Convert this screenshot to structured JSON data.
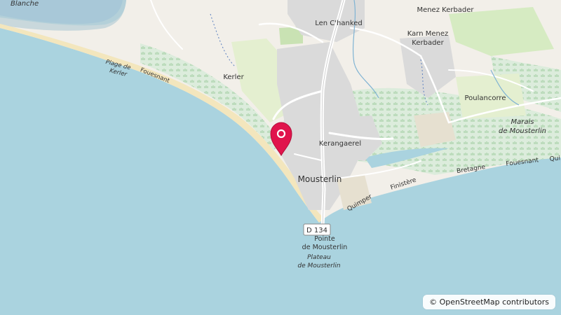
{
  "map": {
    "place_labels": {
      "blanche": "Blanche",
      "len_chanked": "Len C'hanked",
      "menez_kerbader": "Menez Kerbader",
      "karn_menez": "Karn Menez",
      "kerbader": "Kerbader",
      "kerler": "Kerler",
      "plage_de": "Plage de",
      "kerler_beach": "Kerler",
      "fouesnant_coast": "Fouesnant",
      "poulancorre": "Poulancorre",
      "marais_de": "Marais",
      "de_mousterlin": "de Mousterlin",
      "kerangaerel": "Kerangaerel",
      "mousterlin": "Mousterlin",
      "bretagne": "Bretagne",
      "fouesnant_road": "Fouesnant",
      "quimper_partial": "Qui",
      "finistere": "Finistère",
      "quimper": "Quimper",
      "pointe": "Pointe",
      "pointe_de_mousterlin": "de Mousterlin",
      "plateau": "Plateau",
      "plateau_de_mousterlin": "de Mousterlin"
    },
    "road_shield": "D 134",
    "marker": {
      "name": "location-marker",
      "color": "#e0144c"
    },
    "colors": {
      "sea": "#aad3df",
      "land": "#f2efe9",
      "beach": "#f3e6bd",
      "wetland": "#d9ecd9",
      "urban": "#dadada",
      "grass": "#e4efd0",
      "road": "#ffffff"
    }
  },
  "attribution": "© OpenStreetMap contributors"
}
